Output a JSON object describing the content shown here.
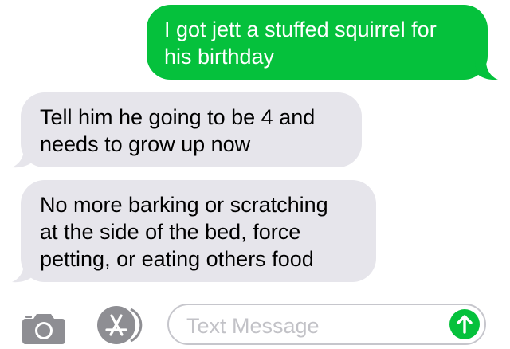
{
  "conversation": {
    "messages": [
      {
        "direction": "sent",
        "text": "I got jett a stuffed squirrel for\nhis birthday"
      },
      {
        "direction": "received",
        "text": "Tell him he going to be 4 and\nneeds to grow up now"
      },
      {
        "direction": "received",
        "text": "No more barking or scratching\nat the side of the bed, force\npetting, or eating others food"
      }
    ]
  },
  "composer": {
    "placeholder": "Text Message",
    "camera_icon": "camera-icon",
    "apps_icon": "app-store-icon",
    "send_icon": "arrow-up-icon"
  },
  "colors": {
    "sent_bubble": "#05c13c",
    "received_bubble": "#e6e5eb",
    "icon_gray": "#8e8e93"
  }
}
